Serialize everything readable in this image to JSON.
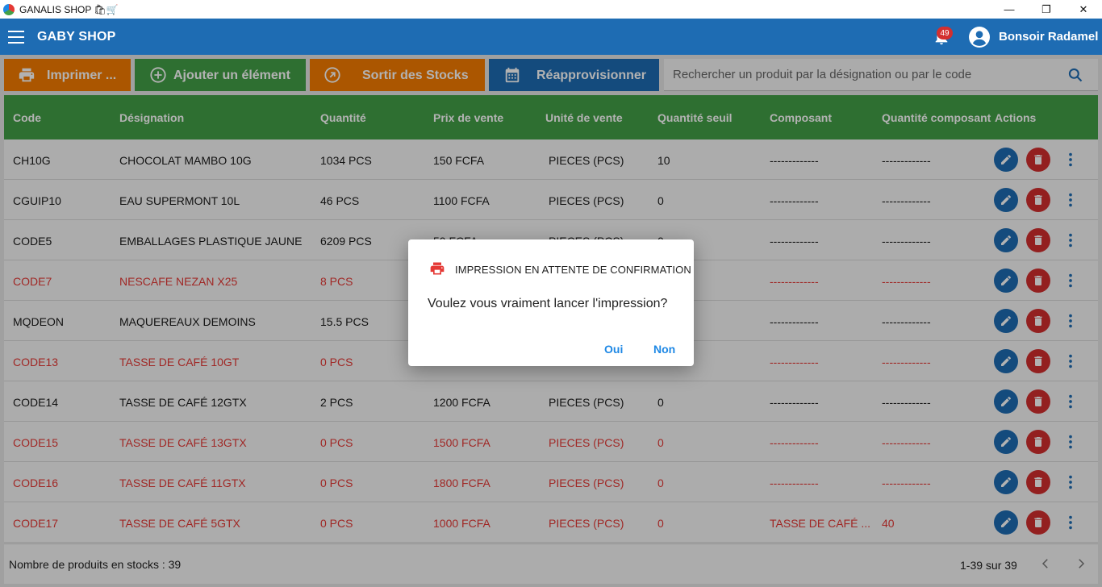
{
  "window": {
    "title": "GANALIS SHOP 🛍🛒",
    "minimize": "—",
    "restore": "❐",
    "close": "✕"
  },
  "appbar": {
    "shop_name": "GABY SHOP",
    "notifications_count": "49",
    "greeting": "Bonsoir Radamel"
  },
  "toolbar": {
    "print_label": "Imprimer ...",
    "add_label": "Ajouter un élément",
    "exit_stock_label": "Sortir des Stocks",
    "restock_label": "Réapprovisionner",
    "search_placeholder": "Rechercher un produit par la désignation ou par le code",
    "colors": {
      "print": "#f57c00",
      "add": "#43a047",
      "exit": "#f57c00",
      "restock": "#1e6cb3"
    }
  },
  "table": {
    "headers": [
      "Code",
      "Désignation",
      "Quantité",
      "Prix de vente",
      "Unité de vente",
      "Quantité seuil",
      "Composant",
      "Quantité composant",
      "Actions"
    ],
    "rows": [
      {
        "code": "CH10G",
        "designation": "CHOCOLAT MAMBO 10G",
        "quantite": "1034  PCS",
        "prix": "150 FCFA",
        "unite": "PIECES  (PCS)",
        "seuil": "10",
        "composant": "-------------",
        "qte_composant": "-------------",
        "alert": false
      },
      {
        "code": "CGUIP10",
        "designation": "EAU SUPERMONT 10L",
        "quantite": "46  PCS",
        "prix": "1100 FCFA",
        "unite": "PIECES  (PCS)",
        "seuil": "0",
        "composant": "-------------",
        "qte_composant": "-------------",
        "alert": false
      },
      {
        "code": "CODE5",
        "designation": "EMBALLAGES PLASTIQUE JAUNE",
        "quantite": "6209  PCS",
        "prix": "50 FCFA",
        "unite": "PIECES  (PCS)",
        "seuil": "0",
        "composant": "-------------",
        "qte_composant": "-------------",
        "alert": false
      },
      {
        "code": "CODE7",
        "designation": "NESCAFE NEZAN X25",
        "quantite": "8  PCS",
        "prix": "",
        "unite": "",
        "seuil": "",
        "composant": "-------------",
        "qte_composant": "-------------",
        "alert": true
      },
      {
        "code": "MQDEON",
        "designation": "MAQUEREAUX DEMOINS",
        "quantite": "15.5  PCS",
        "prix": "",
        "unite": "",
        "seuil": "",
        "composant": "-------------",
        "qte_composant": "-------------",
        "alert": false
      },
      {
        "code": "CODE13",
        "designation": "TASSE DE CAFÉ 10GT",
        "quantite": "0  PCS",
        "prix": "",
        "unite": "",
        "seuil": "",
        "composant": "-------------",
        "qte_composant": "-------------",
        "alert": true
      },
      {
        "code": "CODE14",
        "designation": "TASSE DE CAFÉ 12GTX",
        "quantite": "2  PCS",
        "prix": "1200 FCFA",
        "unite": "PIECES  (PCS)",
        "seuil": "0",
        "composant": "-------------",
        "qte_composant": "-------------",
        "alert": false
      },
      {
        "code": "CODE15",
        "designation": "TASSE DE CAFÉ 13GTX",
        "quantite": "0  PCS",
        "prix": "1500 FCFA",
        "unite": "PIECES  (PCS)",
        "seuil": "0",
        "composant": "-------------",
        "qte_composant": "-------------",
        "alert": true
      },
      {
        "code": "CODE16",
        "designation": "TASSE DE CAFÉ 11GTX",
        "quantite": "0  PCS",
        "prix": "1800 FCFA",
        "unite": "PIECES  (PCS)",
        "seuil": "0",
        "composant": "-------------",
        "qte_composant": "-------------",
        "alert": true
      },
      {
        "code": "CODE17",
        "designation": "TASSE DE CAFÉ 5GTX",
        "quantite": "0  PCS",
        "prix": "1000 FCFA",
        "unite": "PIECES  (PCS)",
        "seuil": "0",
        "composant": "TASSE DE CAFÉ ...",
        "qte_composant": "40",
        "alert": true
      }
    ],
    "footer_count": "Nombre de produits en stocks : 39",
    "footer_range": "1-39 sur 39",
    "alert_color": "#e53935"
  },
  "dialog": {
    "title": "IMPRESSION EN ATTENTE DE CONFIRMATION",
    "message": "Voulez vous vraiment lancer l'impression?",
    "yes_label": "Oui",
    "no_label": "Non",
    "icon": "printer-icon"
  }
}
